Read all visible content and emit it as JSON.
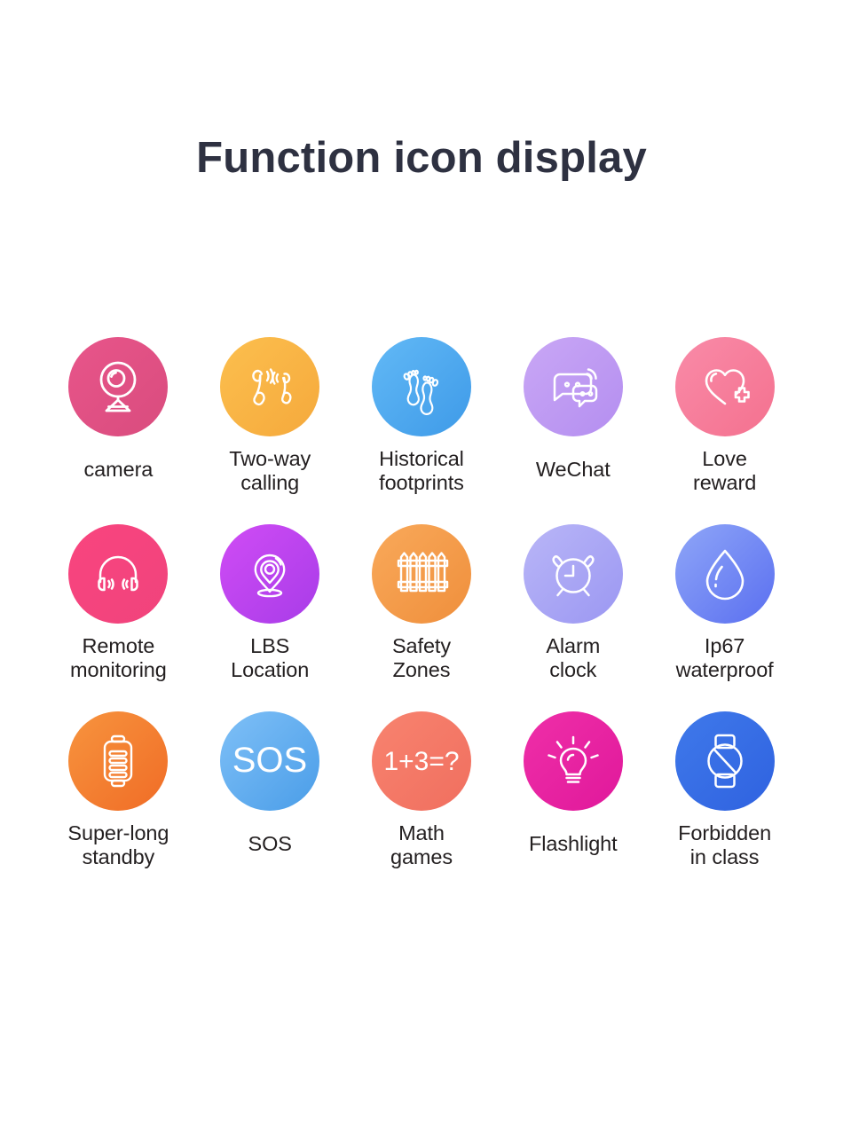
{
  "header": {
    "title": "Function icon display",
    "title_color": "#2e3141"
  },
  "grid": {
    "columns": 5,
    "rows": 3,
    "label_color": "#231f20",
    "stroke_color": "#ffffff",
    "items": [
      {
        "id": "camera",
        "label": "camera",
        "icon": "camera-icon",
        "color_start": "#e8558a",
        "color_end": "#d94c7e",
        "lines": 1
      },
      {
        "id": "two-way-calling",
        "label": "Two-way\ncalling",
        "icon": "phone-handsets-icon",
        "color_start": "#fcbf4e",
        "color_end": "#f5a93c",
        "lines": 2
      },
      {
        "id": "historical-footprints",
        "label": "Historical\nfootprints",
        "icon": "footprints-icon",
        "color_start": "#62b9f6",
        "color_end": "#3e9ae8",
        "lines": 2
      },
      {
        "id": "wechat",
        "label": "WeChat",
        "icon": "chat-bubbles-icon",
        "color_start": "#c9a7f5",
        "color_end": "#b48ef0",
        "lines": 1
      },
      {
        "id": "love-reward",
        "label": "Love\nreward",
        "icon": "heart-plus-icon",
        "color_start": "#f98ba8",
        "color_end": "#f4718f",
        "lines": 2
      },
      {
        "id": "remote-monitoring",
        "label": "Remote\nmonitoring",
        "icon": "headphones-icon",
        "color_start": "#f9457f",
        "color_end": "#f0437c",
        "lines": 2
      },
      {
        "id": "lbs-location",
        "label": "LBS\nLocation",
        "icon": "location-pin-icon",
        "color_start": "#d04cf5",
        "color_end": "#a83ce8",
        "lines": 2
      },
      {
        "id": "safety-zones",
        "label": "Safety\nZones",
        "icon": "fence-icon",
        "color_start": "#f9a95a",
        "color_end": "#ef8f3c",
        "lines": 2
      },
      {
        "id": "alarm-clock",
        "label": "Alarm\nclock",
        "icon": "alarm-clock-icon",
        "color_start": "#b9b6f7",
        "color_end": "#9b97f2",
        "lines": 2
      },
      {
        "id": "ip67-waterproof",
        "label": "Ip67\nwaterproof",
        "icon": "water-drop-icon",
        "color_start": "#8fa6f8",
        "color_end": "#5a6ff0",
        "lines": 2
      },
      {
        "id": "super-long-standby",
        "label": "Super-long\nstandby",
        "icon": "battery-icon",
        "color_start": "#f7943e",
        "color_end": "#f06c26",
        "lines": 2
      },
      {
        "id": "sos",
        "label": "SOS",
        "icon": "sos-icon",
        "icon_text": "SOS",
        "color_start": "#7fc0f7",
        "color_end": "#4a9de8",
        "lines": 1
      },
      {
        "id": "math-games",
        "label": "Math\ngames",
        "icon": "math-equation-icon",
        "icon_text": "1+3=?",
        "color_start": "#f8836f",
        "color_end": "#f06f5f",
        "lines": 2
      },
      {
        "id": "flashlight",
        "label": "Flashlight",
        "icon": "lightbulb-icon",
        "color_start": "#ef2fa8",
        "color_end": "#e0189b",
        "lines": 1
      },
      {
        "id": "forbidden-in-class",
        "label": "Forbidden\nin class",
        "icon": "no-watch-icon",
        "color_start": "#3f79ea",
        "color_end": "#2f62e0",
        "lines": 2
      }
    ]
  }
}
